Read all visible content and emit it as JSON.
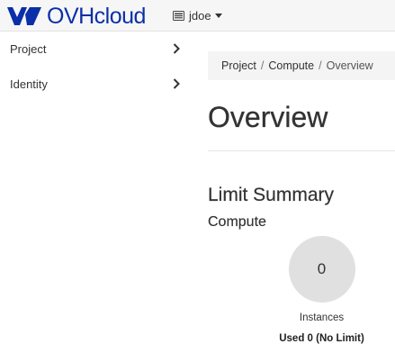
{
  "header": {
    "brand_name": "OVHcloud",
    "brand_color": "#0b2fa8",
    "project_name": "jdoe",
    "project_icon": "server-icon",
    "dropdown_icon": "caret-down-icon"
  },
  "sidebar": {
    "items": [
      {
        "label": "Project",
        "icon": "chevron-right-icon"
      },
      {
        "label": "Identity",
        "icon": "chevron-right-icon"
      }
    ]
  },
  "breadcrumb": {
    "items": [
      "Project",
      "Compute",
      "Overview"
    ],
    "separator": "/"
  },
  "page": {
    "title": "Overview"
  },
  "limit_summary": {
    "title": "Limit Summary",
    "section": "Compute",
    "charts": [
      {
        "value": "0",
        "label": "Instances",
        "usage": "Used 0 (No Limit)"
      }
    ]
  }
}
